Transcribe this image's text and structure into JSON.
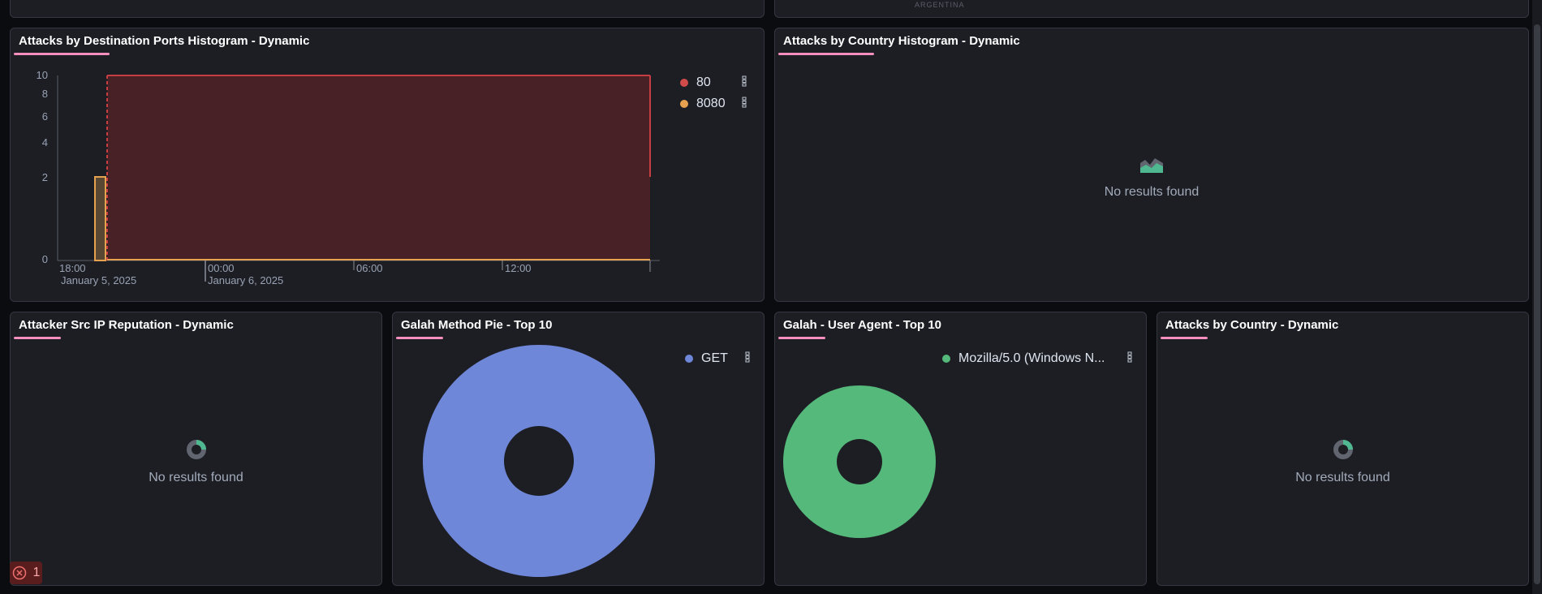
{
  "top_row": {
    "left_panel_title": "",
    "right_panel_fragment": "ARGENTINA"
  },
  "panels": {
    "ports_histogram": {
      "title": "Attacks by Destination Ports Histogram - Dynamic",
      "legend": [
        {
          "label": "80",
          "color": "#d14b4b"
        },
        {
          "label": "8080",
          "color": "#e7a24f"
        }
      ],
      "y_ticks": [
        "10",
        "8",
        "6",
        "4",
        "2",
        "0"
      ],
      "x_ticks": [
        {
          "time": "18:00",
          "date": "January 5, 2025"
        },
        {
          "time": "00:00",
          "date": "January 6, 2025"
        },
        {
          "time": "06:00",
          "date": ""
        },
        {
          "time": "12:00",
          "date": ""
        }
      ]
    },
    "country_histogram": {
      "title": "Attacks by Country Histogram - Dynamic",
      "empty_text": "No results found"
    },
    "src_ip_reputation": {
      "title": "Attacker Src IP Reputation - Dynamic",
      "empty_text": "No results found"
    },
    "method_pie": {
      "title": "Galah Method Pie - Top 10",
      "legend": [
        {
          "label": "GET",
          "color": "#6f87d8"
        }
      ]
    },
    "user_agent": {
      "title": "Galah - User Agent - Top 10",
      "legend": [
        {
          "label": "Mozilla/5.0 (Windows N...",
          "color": "#54b97a"
        }
      ]
    },
    "country_dynamic": {
      "title": "Attacks by Country - Dynamic",
      "empty_text": "No results found"
    }
  },
  "error_badge": {
    "count": "1"
  },
  "chart_data": [
    {
      "type": "area",
      "title": "Attacks by Destination Ports Histogram - Dynamic",
      "xlabel": "",
      "ylabel": "",
      "ylim": [
        0,
        10
      ],
      "y_scale": "log-like",
      "x": [
        "January 5, 2025 21:00",
        "January 5, 2025 22:00",
        "January 6, 2025 15:00"
      ],
      "series": [
        {
          "name": "80",
          "values": [
            0,
            10,
            10
          ],
          "color": "#d14b4b"
        },
        {
          "name": "8080",
          "values": [
            2,
            0,
            0
          ],
          "color": "#e7a24f"
        }
      ],
      "legend_placement": "top-right",
      "grid": false
    },
    {
      "type": "pie",
      "title": "Galah Method Pie - Top 10",
      "categories": [
        "GET"
      ],
      "values": [
        100
      ],
      "colors": [
        "#6f87d8"
      ],
      "legend_placement": "top-right"
    },
    {
      "type": "pie",
      "title": "Galah - User Agent - Top 10",
      "categories": [
        "Mozilla/5.0 (Windows N..."
      ],
      "values": [
        100
      ],
      "colors": [
        "#54b97a"
      ],
      "legend_placement": "top-right"
    }
  ]
}
